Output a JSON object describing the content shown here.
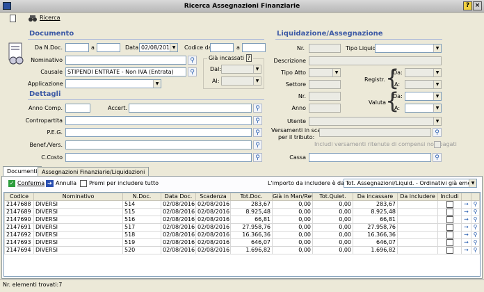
{
  "window": {
    "title": "Ricerca Assegnazioni Finanziarie"
  },
  "toolbar": {
    "search_label": "Ricerca"
  },
  "documento": {
    "title": "Documento",
    "n_doc_label": "Da N.Doc.",
    "a_label": "a",
    "data_label": "Data",
    "data_value": "02/08/2016",
    "codice_label": "Codice da",
    "codice_a_label": "a",
    "nominativo_label": "Nominativo",
    "causale_label": "Causale",
    "causale_value": "STIPENDI ENTRATE - Non IVA (Entrata)",
    "applicazione_label": "Applicazione",
    "incassati_label": "Già incassati",
    "incassati_help": "?",
    "dal_label": "Dal:",
    "al_label": "Al:"
  },
  "dettagli": {
    "title": "Dettagli",
    "anno_comp_label": "Anno Comp.",
    "accert_label": "Accert.",
    "contropartita_label": "Contropartita",
    "peg_label": "P.E.G.",
    "benef_label": "Benef./Vers.",
    "ccosto_label": "C.Costo"
  },
  "liquidazione": {
    "title": "Liquidazione/Assegnazione",
    "nr_label": "Nr.",
    "tipo_liquid_label": "Tipo Liquid.",
    "descrizione_label": "Descrizione",
    "tipo_atto_label": "Tipo Atto",
    "settore_label": "Settore",
    "registr_label": "Registr.",
    "nr2_label": "Nr.",
    "anno_label": "Anno",
    "valuta_label": "Valuta",
    "da_label": "Da:",
    "a_label": "A:",
    "utente_label": "Utente",
    "versamenti_label1": "Versamenti in scad.",
    "versamenti_label2": "per il tributo:",
    "includi_versamenti_label": "Includi versamenti ritenute di compensi non pagati",
    "cassa_label": "Cassa"
  },
  "tabs": [
    {
      "label": "Documenti"
    },
    {
      "label": "Assegnazioni Finanziarie/Liquidazioni"
    }
  ],
  "docs_toolbar": {
    "conferma_label": "Conferma",
    "annulla_label": "Annulla",
    "premi_label": "Premi per includere tutto",
    "importo_label": "L'importo da includere è dato da:",
    "importo_value": "Tot. Assegnazioni/Liquid. - Ordinativi già emessi"
  },
  "table": {
    "headers": [
      "Codice",
      "Nominativo",
      "N.Doc.",
      "Data Doc.",
      "Scadenza",
      "Tot.Doc.",
      "Già in Man/Rev.",
      "Tot.Quiet.",
      "Da incassare",
      "Da includere",
      "Includi"
    ],
    "rows": [
      [
        "2147688",
        "DIVERSI",
        "514",
        "02/08/2016",
        "02/08/2016",
        "283,67",
        "0,00",
        "0,00",
        "283,67",
        ""
      ],
      [
        "2147689",
        "DIVERSI",
        "515",
        "02/08/2016",
        "02/08/2016",
        "8.925,48",
        "0,00",
        "0,00",
        "8.925,48",
        ""
      ],
      [
        "2147690",
        "DIVERSI",
        "516",
        "02/08/2016",
        "02/08/2016",
        "66,81",
        "0,00",
        "0,00",
        "66,81",
        ""
      ],
      [
        "2147691",
        "DIVERSI",
        "517",
        "02/08/2016",
        "02/08/2016",
        "27.958,76",
        "0,00",
        "0,00",
        "27.958,76",
        ""
      ],
      [
        "2147692",
        "DIVERSI",
        "518",
        "02/08/2016",
        "02/08/2016",
        "16.366,36",
        "0,00",
        "0,00",
        "16.366,36",
        ""
      ],
      [
        "2147693",
        "DIVERSI",
        "519",
        "02/08/2016",
        "02/08/2016",
        "646,07",
        "0,00",
        "0,00",
        "646,07",
        ""
      ],
      [
        "2147694",
        "DIVERSI",
        "520",
        "02/08/2016",
        "02/08/2016",
        "1.696,82",
        "0,00",
        "0,00",
        "1.696,82",
        ""
      ]
    ]
  },
  "status": {
    "text": "Nr. elementi trovati:7"
  },
  "colors": {
    "section": "#3d5aa5",
    "title_bar": "#c8c8c8"
  }
}
